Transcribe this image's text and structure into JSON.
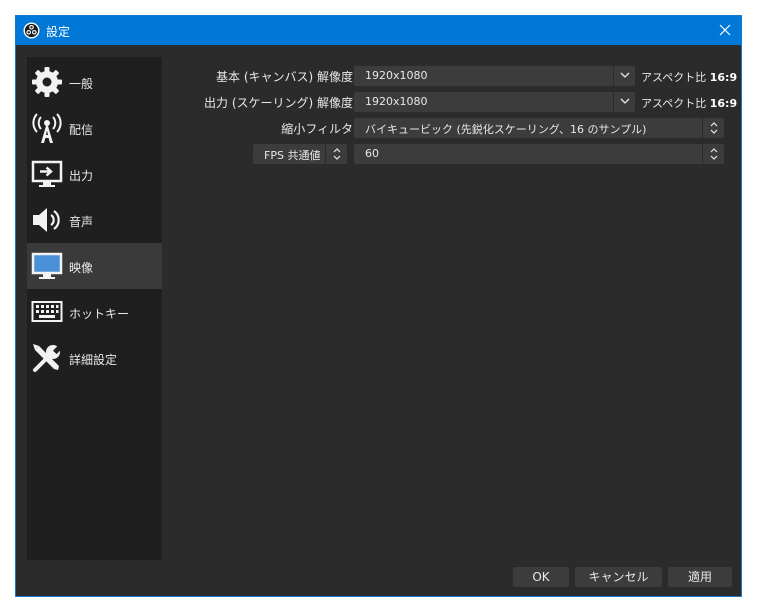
{
  "window": {
    "title": "設定"
  },
  "sidebar": {
    "items": [
      {
        "label": "一般",
        "icon": "gear-icon"
      },
      {
        "label": "配信",
        "icon": "broadcast-antenna-icon"
      },
      {
        "label": "出力",
        "icon": "monitor-output-icon"
      },
      {
        "label": "音声",
        "icon": "speaker-icon"
      },
      {
        "label": "映像",
        "icon": "monitor-icon",
        "selected": true
      },
      {
        "label": "ホットキー",
        "icon": "keyboard-icon"
      },
      {
        "label": "詳細設定",
        "icon": "tools-icon"
      }
    ]
  },
  "video": {
    "base_resolution": {
      "label": "基本 (キャンバス) 解像度",
      "value": "1920x1080",
      "aspect_label": "アスペクト比",
      "aspect_value": "16:9"
    },
    "output_resolution": {
      "label": "出力 (スケーリング) 解像度",
      "value": "1920x1080",
      "aspect_label": "アスペクト比",
      "aspect_value": "16:9"
    },
    "downscale_filter": {
      "label": "縮小フィルタ",
      "value": "バイキュービック (先鋭化スケーリング、16 のサンプル)"
    },
    "fps": {
      "type_value": "FPS 共通値",
      "value": "60"
    }
  },
  "buttons": {
    "ok": "OK",
    "cancel": "キャンセル",
    "apply": "適用"
  },
  "colors": {
    "titlebar": "#0078d7",
    "background": "#2b2b2b",
    "sidebar": "#1f1f1f",
    "control": "#3c3c3c"
  }
}
